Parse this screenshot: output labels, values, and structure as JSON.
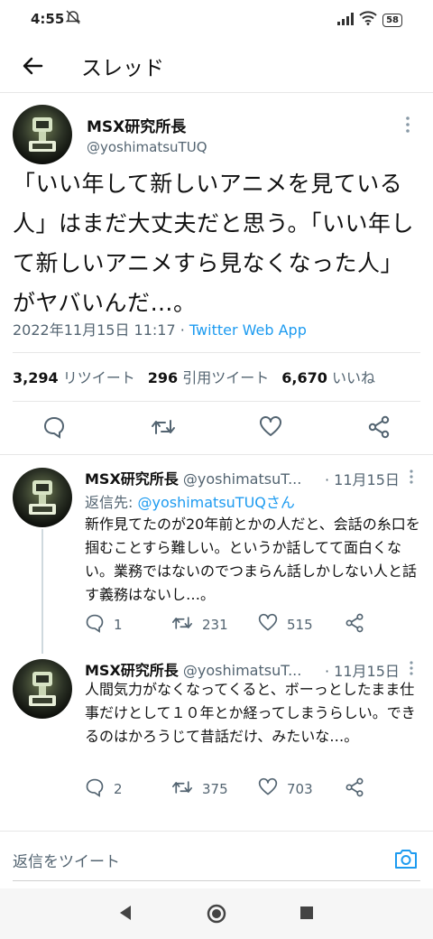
{
  "status_bar": {
    "time": "4:55",
    "battery": "58"
  },
  "app_bar": {
    "title": "スレッド"
  },
  "main_tweet": {
    "name": "MSX研究所長",
    "handle": "@yoshimatsuTUQ",
    "text": "「いい年して新しいアニメを見ている人」はまだ大丈夫だと思う。「いい年して新しいアニメすら見なくなった人」がヤバいんだ…。",
    "timestamp": "2022年11月15日 11:17",
    "separator": " · ",
    "source": "Twitter Web App",
    "retweets_count": "3,294",
    "retweets_label": "リツイート",
    "quotes_count": "296",
    "quotes_label": "引用ツイート",
    "likes_count": "6,670",
    "likes_label": "いいね"
  },
  "replies": [
    {
      "name": "MSX研究所長",
      "handle": "@yoshimatsuT...",
      "date": "· 11月15日",
      "reply_to_label": "返信先: ",
      "reply_to_handle": "@yoshimatsuTUQさん",
      "text": "新作見てたのが20年前とかの人だと、会話の糸口を掴むことすら難しい。というか話してて面白くない。業務ではないのでつまらん話しかしない人と話す義務はないし…。",
      "replies": "1",
      "retweets": "231",
      "likes": "515"
    },
    {
      "name": "MSX研究所長",
      "handle": "@yoshimatsuT...",
      "date": "· 11月15日",
      "text": "人間気力がなくなってくると、ボーっとしたまま仕事だけとして１０年とか経ってしまうらしい。できるのはかろうじて昔話だけ、みたいな…。",
      "replies": "2",
      "retweets": "375",
      "likes": "703"
    }
  ],
  "reply_bar": {
    "placeholder": "返信をツイート"
  },
  "colors": {
    "accent": "#1d9bf0",
    "secondary_text": "#536471",
    "divider": "#e7e7e7"
  }
}
